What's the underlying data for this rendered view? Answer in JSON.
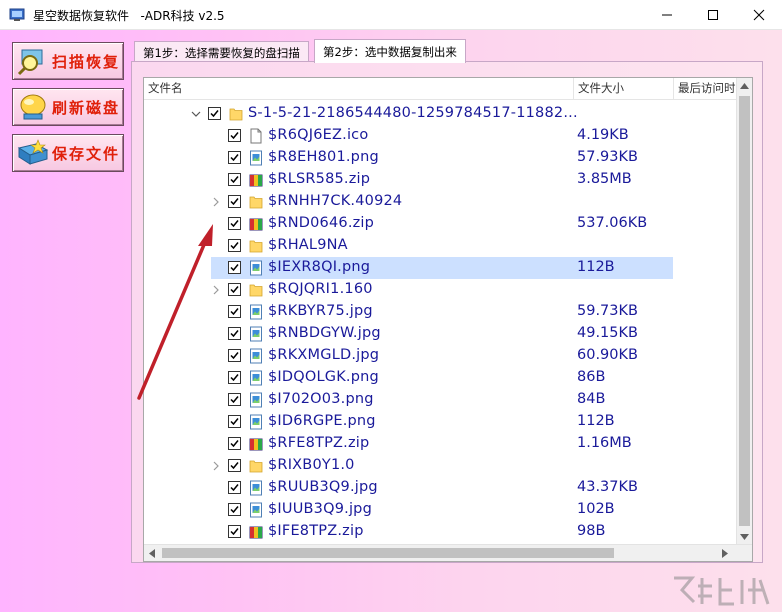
{
  "window": {
    "title": "星空数据恢复软件   -ADR科技 v2.5"
  },
  "sidebar": {
    "buttons": [
      {
        "label": "扫描恢复",
        "icon": "scan-search-icon"
      },
      {
        "label": "刷新磁盘",
        "icon": "refresh-disk-icon"
      },
      {
        "label": "保存文件",
        "icon": "save-files-icon"
      }
    ]
  },
  "tabs": [
    {
      "label": "第1步：选择需要恢复的盘扫描",
      "active": false
    },
    {
      "label": "第2步：选中数据复制出来",
      "active": true
    }
  ],
  "table": {
    "columns": [
      "文件名",
      "文件大小",
      "最后访问时"
    ],
    "rows": [
      {
        "name": "S-1-5-21-2186544480-1259784517-11882...",
        "size": "",
        "type": "folder",
        "expand": "expanded",
        "level": 0,
        "selected": false
      },
      {
        "name": "$R6QJ6EZ.ico",
        "size": "4.19KB",
        "type": "file",
        "expand": "",
        "level": 1,
        "selected": false
      },
      {
        "name": "$R8EH801.png",
        "size": "57.93KB",
        "type": "image",
        "expand": "",
        "level": 1,
        "selected": false
      },
      {
        "name": "$RLSR585.zip",
        "size": "3.85MB",
        "type": "zip",
        "expand": "",
        "level": 1,
        "selected": false
      },
      {
        "name": "$RNHH7CK.40924",
        "size": "",
        "type": "folder",
        "expand": "collapsed",
        "level": 1,
        "selected": false
      },
      {
        "name": "$RND0646.zip",
        "size": "537.06KB",
        "type": "zip",
        "expand": "",
        "level": 1,
        "selected": false
      },
      {
        "name": "$RHAL9NA",
        "size": "",
        "type": "folder",
        "expand": "",
        "level": 1,
        "selected": false
      },
      {
        "name": "$IEXR8QI.png",
        "size": "112B",
        "type": "image",
        "expand": "",
        "level": 1,
        "selected": true
      },
      {
        "name": "$RQJQRI1.160",
        "size": "",
        "type": "folder",
        "expand": "collapsed",
        "level": 1,
        "selected": false
      },
      {
        "name": "$RKBYR75.jpg",
        "size": "59.73KB",
        "type": "image",
        "expand": "",
        "level": 1,
        "selected": false
      },
      {
        "name": "$RNBDGYW.jpg",
        "size": "49.15KB",
        "type": "image",
        "expand": "",
        "level": 1,
        "selected": false
      },
      {
        "name": "$RKXMGLD.jpg",
        "size": "60.90KB",
        "type": "image",
        "expand": "",
        "level": 1,
        "selected": false
      },
      {
        "name": "$IDQOLGK.png",
        "size": "86B",
        "type": "image",
        "expand": "",
        "level": 1,
        "selected": false
      },
      {
        "name": "$I702O03.png",
        "size": "84B",
        "type": "image",
        "expand": "",
        "level": 1,
        "selected": false
      },
      {
        "name": "$ID6RGPE.png",
        "size": "112B",
        "type": "image",
        "expand": "",
        "level": 1,
        "selected": false
      },
      {
        "name": "$RFE8TPZ.zip",
        "size": "1.16MB",
        "type": "zip",
        "expand": "",
        "level": 1,
        "selected": false
      },
      {
        "name": "$RIXB0Y1.0",
        "size": "",
        "type": "folder",
        "expand": "collapsed",
        "level": 1,
        "selected": false
      },
      {
        "name": "$RUUB3Q9.jpg",
        "size": "43.37KB",
        "type": "image",
        "expand": "",
        "level": 1,
        "selected": false
      },
      {
        "name": "$IUUB3Q9.jpg",
        "size": "102B",
        "type": "image",
        "expand": "",
        "level": 1,
        "selected": false
      },
      {
        "name": "$IFE8TPZ.zip",
        "size": "98B",
        "type": "zip",
        "expand": "",
        "level": 1,
        "selected": false
      }
    ]
  },
  "colors": {
    "accent_red": "#e0200a",
    "selection": "#cce0ff",
    "file_text": "#1a1a9a",
    "annotation_arrow": "#c0202a"
  }
}
